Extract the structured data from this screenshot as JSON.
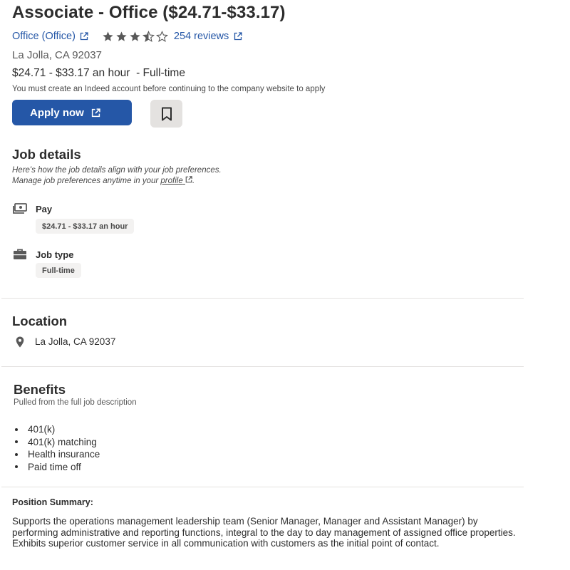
{
  "job": {
    "title": "Associate - Office ($24.71-$33.17)",
    "company": "Office (Office)",
    "rating_stars": 3.5,
    "reviews": "254 reviews",
    "location": "La Jolla, CA 92037",
    "salary_line": "$24.71 - $33.17 an hour  - Full-time",
    "notice": "You must create an Indeed account before continuing to the company website to apply",
    "apply_label": "Apply now",
    "save_icon": "bookmark-icon"
  },
  "job_details": {
    "heading": "Job details",
    "line1": "Here's how the job details align with your job preferences.",
    "line2_prefix": "Manage job preferences anytime in your ",
    "line2_link": "profile",
    "line2_suffix": ".",
    "pay_label": "Pay",
    "pay_value": "$24.71 - $33.17 an hour",
    "jobtype_label": "Job type",
    "jobtype_value": "Full-time"
  },
  "location_section": {
    "heading": "Location",
    "value": "La Jolla, CA 92037"
  },
  "benefits": {
    "heading": "Benefits",
    "subtitle": "Pulled from the full job description",
    "items": [
      "401(k)",
      "401(k) matching",
      "Health insurance",
      "Paid time off"
    ]
  },
  "description": {
    "heading": "Position Summary:",
    "body": "Supports the operations management leadership team (Senior Manager, Manager and Assistant Manager) by performing administrative and reporting functions, integral to the day to day management of assigned office properties. Exhibits superior customer service in all communication with customers as the initial point of contact."
  },
  "colors": {
    "link": "#2557a7",
    "primary_button": "#2557a7",
    "pill_bg": "#f3f2f1"
  }
}
